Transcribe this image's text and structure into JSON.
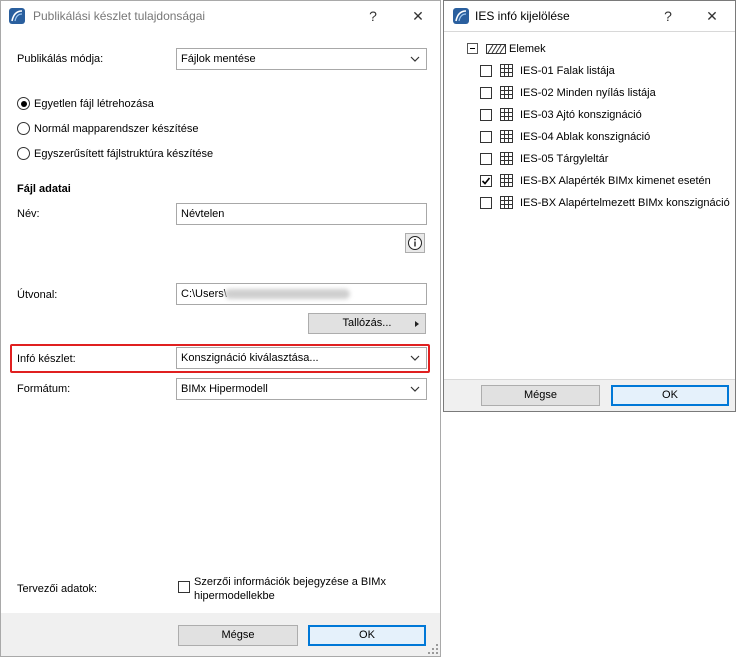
{
  "left_dialog": {
    "title": "Publikálási készlet tulajdonságai",
    "help_glyph": "?",
    "close_glyph": "✕",
    "publish_mode_label": "Publikálás módja:",
    "publish_mode_value": "Fájlok mentése",
    "radio_options": [
      {
        "label": "Egyetlen fájl létrehozása",
        "selected": true
      },
      {
        "label": "Normál mapparendszer készítése",
        "selected": false
      },
      {
        "label": "Egyszerűsített fájlstruktúra készítése",
        "selected": false
      }
    ],
    "file_data_heading": "Fájl adatai",
    "name_label": "Név:",
    "name_value": "Névtelen",
    "path_label": "Útvonal:",
    "path_value": "C:\\Users\\",
    "browse_label": "Tallózás...",
    "info_set_label": "Infó készlet:",
    "info_set_value": "Konszignáció kiválasztása...",
    "format_label": "Formátum:",
    "format_value": "BIMx Hipermodell",
    "designer_label": "Tervezői adatok:",
    "designer_checkbox_line1": "Szerzői információk bejegyzése a BIMx",
    "designer_checkbox_line2": "hipermodellekbe",
    "designer_checked": false,
    "cancel_label": "Mégse",
    "ok_label": "OK",
    "highlight_color": "#e02020"
  },
  "right_dialog": {
    "title": "IES infó kijelölése",
    "help_glyph": "?",
    "close_glyph": "✕",
    "root_label": "Elemek",
    "items": [
      {
        "label": "IES-01 Falak listája",
        "checked": false
      },
      {
        "label": "IES-02 Minden nyílás listája",
        "checked": false
      },
      {
        "label": "IES-03 Ajtó konszignáció",
        "checked": false
      },
      {
        "label": "IES-04 Ablak konszignáció",
        "checked": false
      },
      {
        "label": "IES-05 Tárgyleltár",
        "checked": false
      },
      {
        "label": "IES-BX Alapérték BIMx kimenet esetén",
        "checked": true
      },
      {
        "label": "IES-BX Alapértelmezett BIMx konszignáció",
        "checked": false
      }
    ],
    "cancel_label": "Mégse",
    "ok_label": "OK"
  }
}
